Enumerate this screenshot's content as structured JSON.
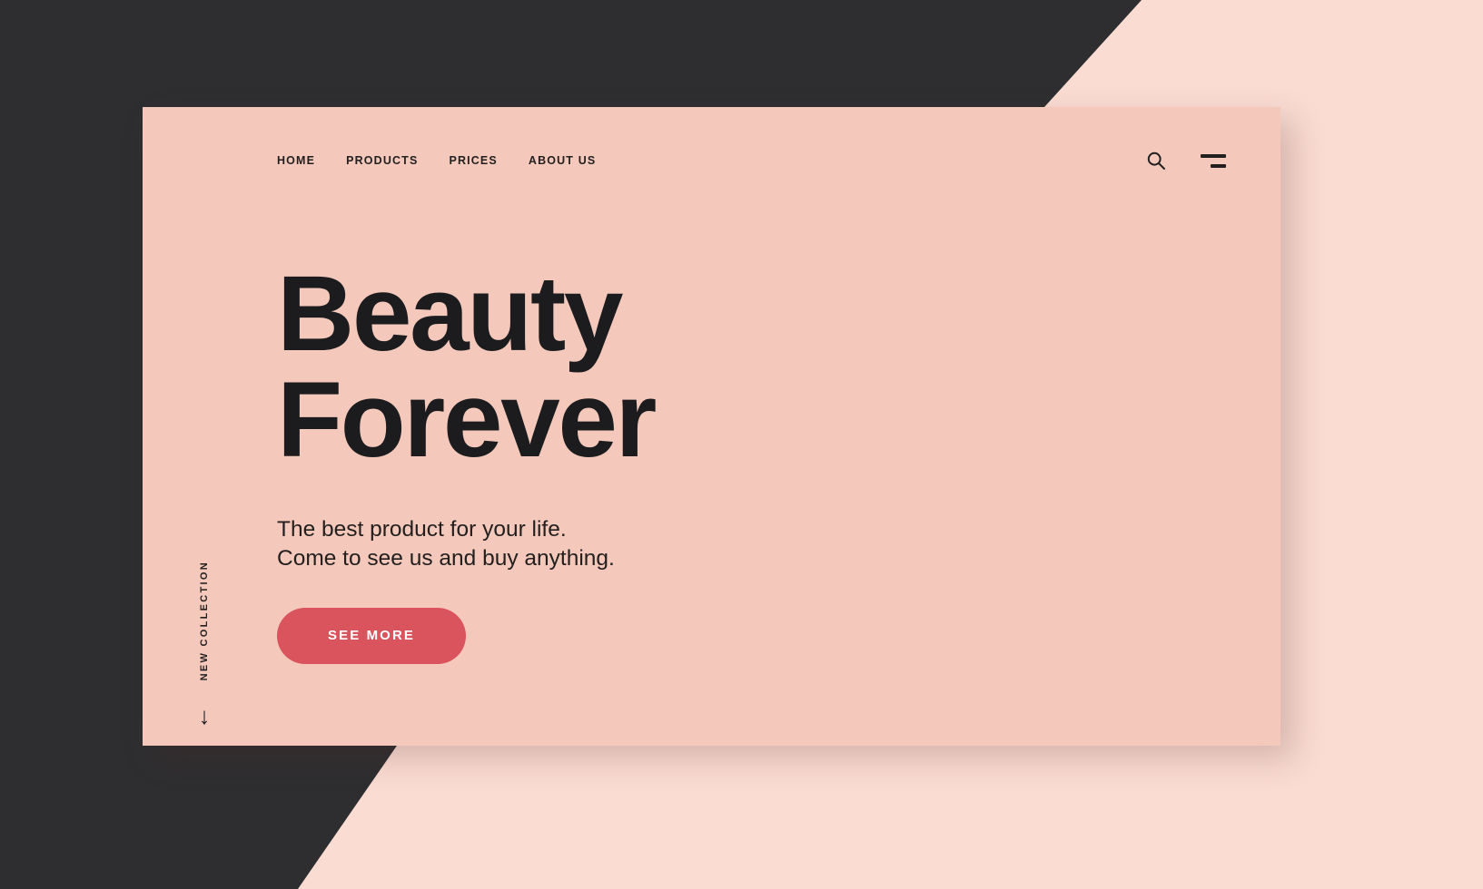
{
  "theme": {
    "dark_bg": "#2e2e30",
    "backdrop_pink": "#fadcd3",
    "card_pink": "#f4c9bc",
    "accent_red": "#d9545c",
    "text_dark": "#231f1e"
  },
  "nav": {
    "links": [
      {
        "label": "HOME"
      },
      {
        "label": "PRODUCTS"
      },
      {
        "label": "PRICES"
      },
      {
        "label": "ABOUT US"
      }
    ],
    "search_icon": "search-icon",
    "menu_icon": "hamburger-menu-icon"
  },
  "hero": {
    "headline_line1": "Beauty",
    "headline_line2": "Forever",
    "subtitle_line1": "The best product for your life.",
    "subtitle_line2": "Come to see us and buy anything.",
    "cta_label": "SEE MORE"
  },
  "side_rail": {
    "vertical_label": "NEW COLLECTION",
    "scroll_arrow": "↓"
  }
}
